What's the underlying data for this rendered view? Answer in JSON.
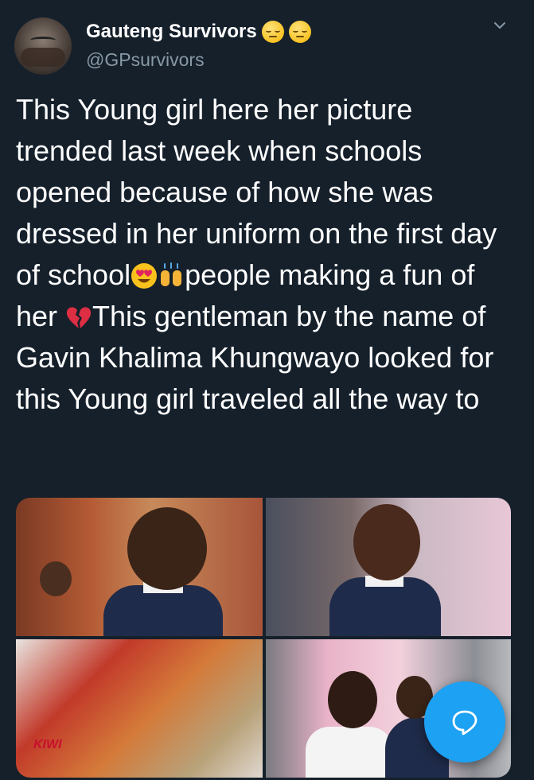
{
  "tweet": {
    "author": {
      "display_name": "Gauteng Survivors",
      "name_emojis": [
        "relieved-face-emoji",
        "relieved-face-emoji"
      ],
      "handle": "@GPsurvivors"
    },
    "text_parts": [
      "This Young girl here her picture trended last week when schools opened because of how she was dressed in her uniform on the first day of school",
      "people making a fun of her ",
      "This gentleman by the name of Gavin Khalima Khungwayo looked for this Young girl traveled all the way to"
    ],
    "inline_emojis": [
      "heart-eyes-emoji",
      "raising-hands-emoji",
      "broken-heart-emoji"
    ],
    "media": [
      {
        "name": "girl-in-classroom-photo"
      },
      {
        "name": "girl-in-store-photo"
      },
      {
        "name": "groceries-photo",
        "label": "KIWI"
      },
      {
        "name": "man-with-girl-selfie-photo"
      }
    ]
  },
  "actions": {
    "more_icon": "chevron-down-icon",
    "compose_icon": "reply-bubble-icon"
  },
  "colors": {
    "background": "#15202b",
    "text": "#ffffff",
    "secondary_text": "#8899a6",
    "accent": "#1da1f2"
  }
}
